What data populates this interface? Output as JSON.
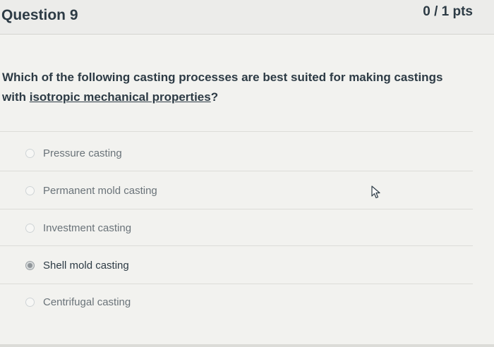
{
  "header": {
    "title": "Question 9",
    "points": "0 / 1 pts"
  },
  "question": {
    "text_part1": "Which of the following casting processes are best suited for making castings with",
    "text_underlined": "isotropic mechanical properties",
    "text_part2": "?"
  },
  "answers": [
    {
      "label": "Pressure casting",
      "selected": false
    },
    {
      "label": "Permanent mold casting",
      "selected": false
    },
    {
      "label": "Investment casting",
      "selected": false
    },
    {
      "label": "Shell mold casting",
      "selected": true
    },
    {
      "label": "Centrifugal casting",
      "selected": false
    }
  ],
  "icons": {
    "cursor": "mouse-pointer-icon"
  }
}
